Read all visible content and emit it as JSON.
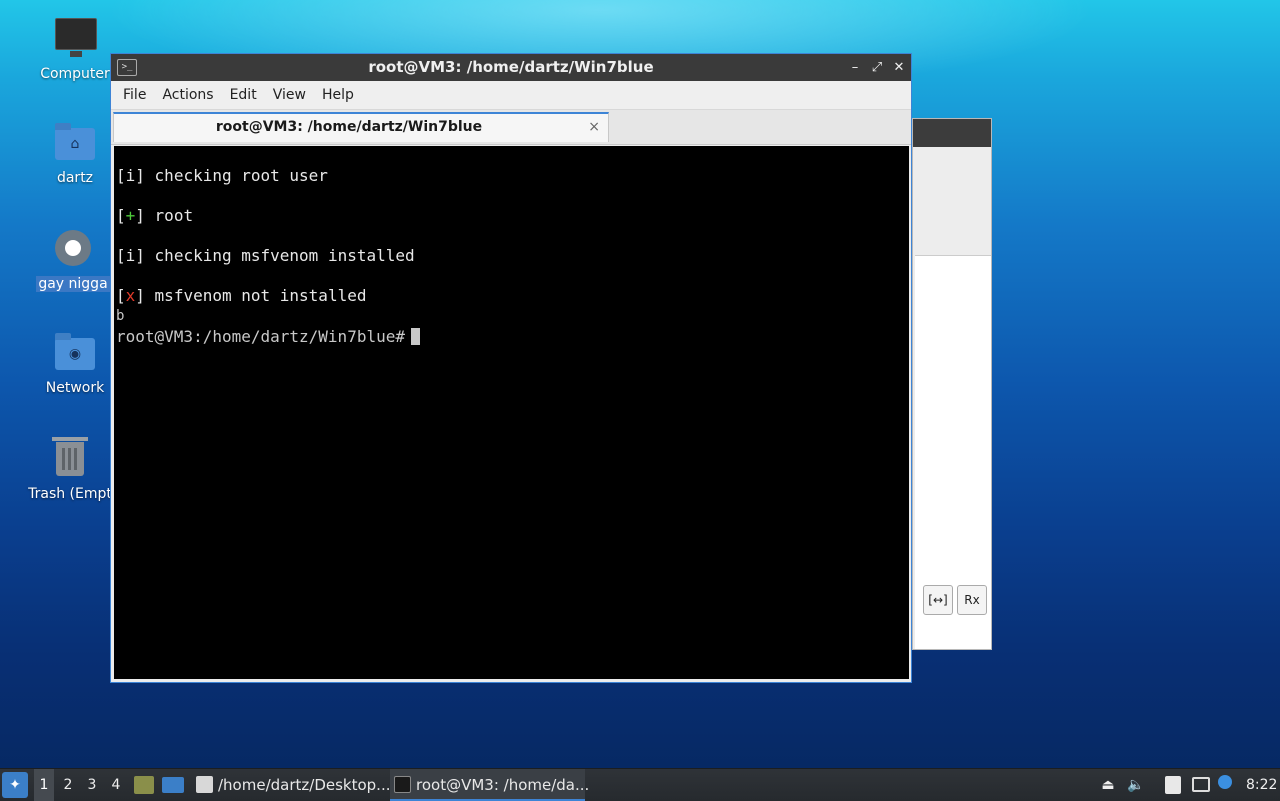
{
  "desktop": {
    "icons": [
      {
        "label": "Computer",
        "icon": "computer-icon"
      },
      {
        "label": "dartz",
        "icon": "home-folder-icon"
      },
      {
        "label": "gay nigga",
        "icon": "settings-gear-icon"
      },
      {
        "label": "Network",
        "icon": "network-folder-icon"
      },
      {
        "label": "Trash (Empt",
        "icon": "trash-icon"
      }
    ]
  },
  "terminal": {
    "window_title": "root@VM3: /home/dartz/Win7blue",
    "menu": [
      "File",
      "Actions",
      "Edit",
      "View",
      "Help"
    ],
    "tab_label": "root@VM3: /home/dartz/Win7blue",
    "tab_close": "×",
    "lines": {
      "l1_open": "[",
      "l1_mark": "i",
      "l1_rest": "] checking root user",
      "l2_open": "[",
      "l2_mark": "+",
      "l2_rest": "] root",
      "l3_open": "[",
      "l3_mark": "i",
      "l3_rest": "] checking msfvenom installed",
      "l4_open": "[",
      "l4_mark": "x",
      "l4_rest": "] msfvenom not installed",
      "l5": "b",
      "prompt": "root@VM3:/home/dartz/Win7blue#"
    },
    "colors": {
      "plus": "#4ecb3a",
      "x": "#e23b2a",
      "accent": "#3d84d6"
    }
  },
  "background_window": {
    "btn1": "[↔]",
    "btn2": "Rx"
  },
  "taskbar": {
    "workspaces": [
      "1",
      "2",
      "3",
      "4"
    ],
    "tasks": [
      {
        "label": "/home/dartz/Desktop...",
        "icon": "text-editor-icon"
      },
      {
        "label": "root@VM3: /home/da...",
        "icon": "terminal-icon"
      }
    ],
    "clock": "8:22"
  }
}
